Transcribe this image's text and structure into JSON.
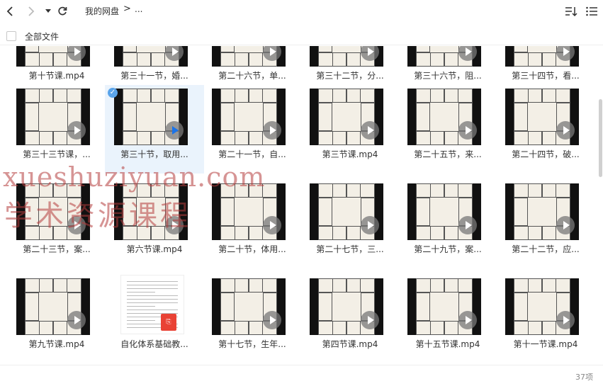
{
  "breadcrumb": {
    "root": "我的网盘",
    "separator": ">",
    "more": "..."
  },
  "select_all_label": "全部文件",
  "item_count": "37项",
  "watermark": {
    "line1": "xueshuziyuan.com",
    "line2": "学术资源课程"
  },
  "rows": [
    [
      "第十节课.mp4",
      "第三十一节，婚...",
      "第二十六节，单...",
      "第三十二节，分...",
      "第三十六节，阻...",
      "第三十四节，看..."
    ],
    [
      "第三十三节课，...",
      "第三十节，取用...",
      "第二十一节，自...",
      "第三节课.mp4",
      "第二十五节，来...",
      "第二十四节，破..."
    ],
    [
      "第二十三节，案...",
      "第六节课.mp4",
      "第二十节，体用...",
      "第二十七节，三...",
      "第二十九节，案...",
      "第二十二节，应..."
    ],
    [
      "第九节课.mp4",
      "自化体系基础教...",
      "第十七节，生年...",
      "第四节课.mp4",
      "第十五节课.mp4",
      "第十一节课.mp4"
    ]
  ]
}
